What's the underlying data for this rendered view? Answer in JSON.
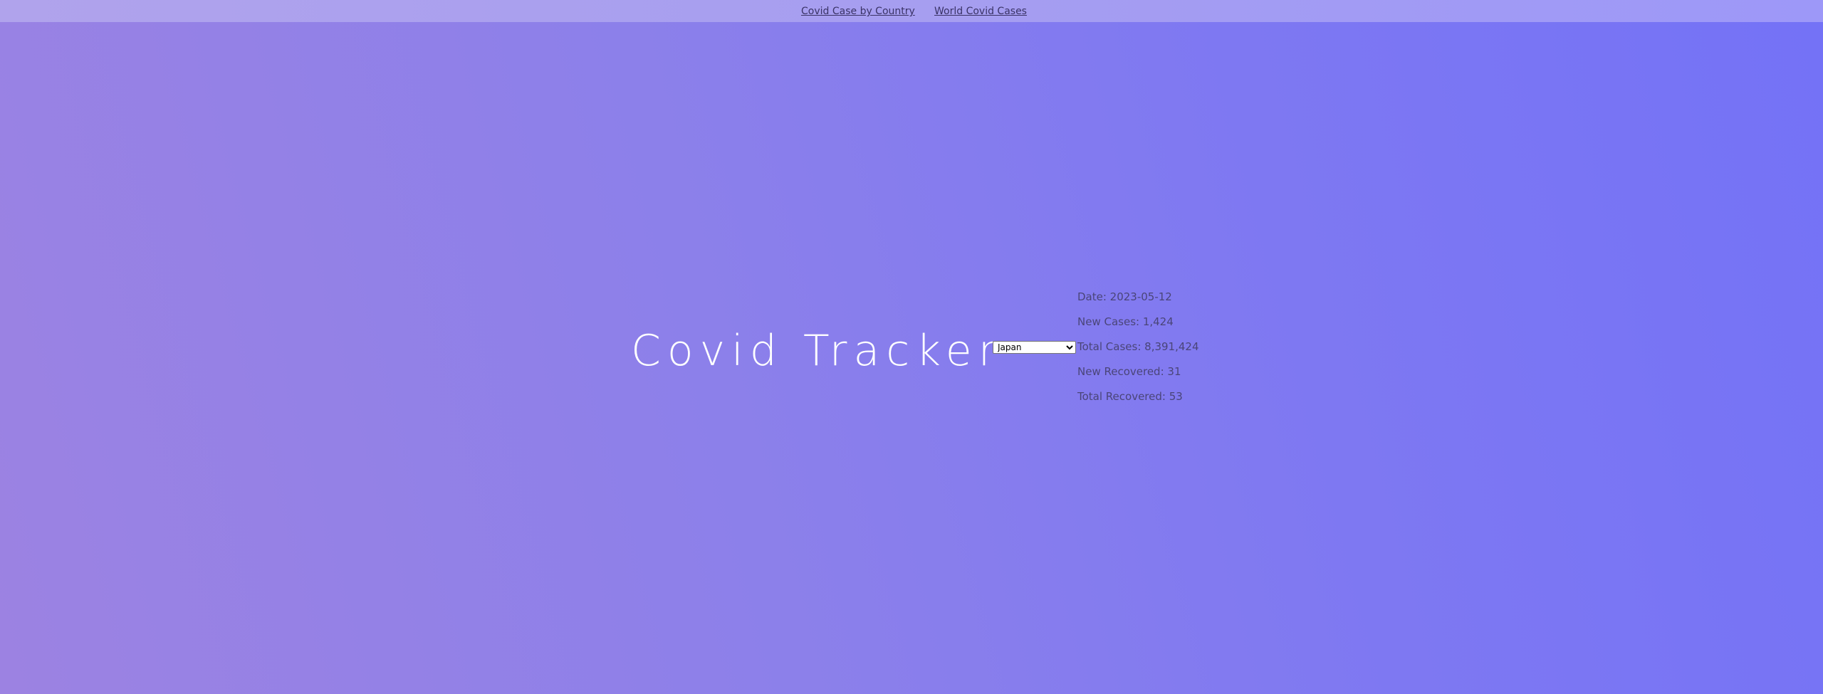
{
  "nav": {
    "links": [
      {
        "label": "Covid Case by Country"
      },
      {
        "label": "World Covid Cases"
      }
    ]
  },
  "hero": {
    "title": "Covid Tracker"
  },
  "country_select": {
    "selected": "Japan"
  },
  "stats": {
    "date": "Date: 2023-05-12",
    "new_cases": "New Cases: 1,424",
    "total_cases": "Total Cases: 8,391,424",
    "new_recovered": "New Recovered: 31",
    "total_recovered": "Total Recovered: 53"
  },
  "colors": {
    "background_start": "#9c82e2",
    "background_end": "#7472f6",
    "nav_bar": "#a69ef0",
    "title": "#ffffff",
    "stat_text": "#4a4578"
  }
}
